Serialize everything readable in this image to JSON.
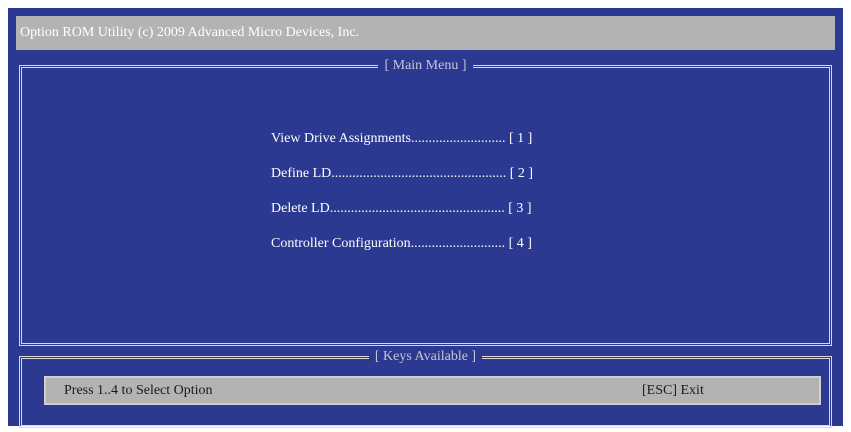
{
  "window": {
    "title": "Option ROM Utility (c) 2009 Advanced Micro Devices, Inc."
  },
  "main_menu": {
    "title": "[ Main Menu ]",
    "items": [
      {
        "label": "View Drive Assignments",
        "leader": "...........................",
        "key": "[ 1 ]"
      },
      {
        "label": "Define LD",
        "leader": "..................................................",
        "key": "[ 2 ]"
      },
      {
        "label": "Delete LD",
        "leader": "..................................................",
        "key": "[ 3 ]"
      },
      {
        "label": "Controller Configuration",
        "leader": "...........................",
        "key": "[ 4 ]"
      }
    ]
  },
  "keys_panel": {
    "title": "[ Keys Available ]",
    "left_hint": "Press 1..4 to Select Option",
    "right_hint": "[ESC] Exit"
  },
  "colors": {
    "background": "#2b3990",
    "bar": "#b3b3b3",
    "text": "#ffffff"
  }
}
